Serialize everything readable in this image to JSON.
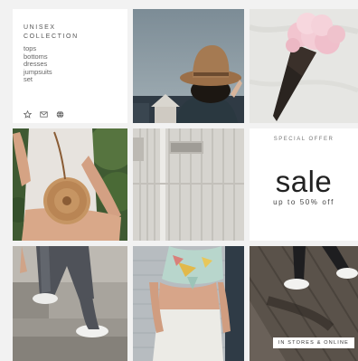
{
  "collection": {
    "title_line1": "UNISEX",
    "title_line2": "COLLECTION",
    "categories": [
      "tops",
      "bottoms",
      "dresses",
      "jumpsuits",
      "set"
    ],
    "icons": [
      "star-icon",
      "mail-icon",
      "globe-icon"
    ]
  },
  "offer": {
    "label": "SPECIAL OFFER",
    "title": "sale",
    "subtitle": "up to 50% off"
  },
  "banner": {
    "label": "IN STORES & ONLINE"
  },
  "colors": {
    "background": "#f2f2f2",
    "panel": "#ffffff",
    "text": "#555555",
    "heading": "#222222"
  }
}
